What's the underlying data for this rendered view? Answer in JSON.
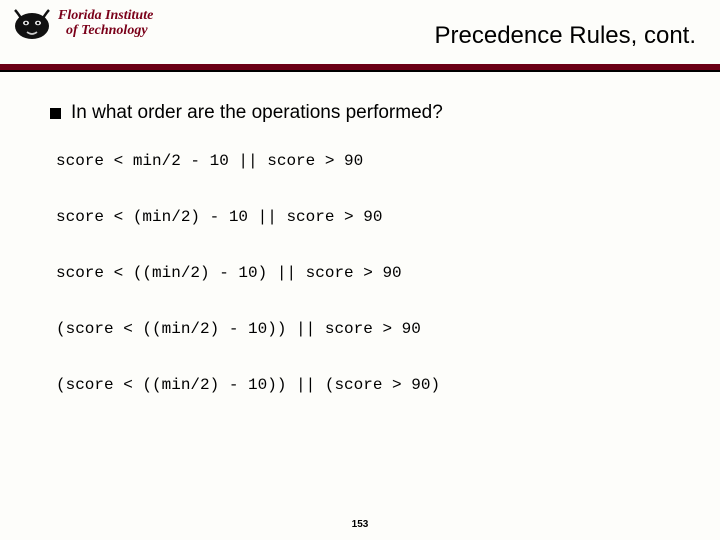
{
  "logo": {
    "line1": "Florida Institute",
    "line2": "of Technology"
  },
  "title": "Precedence Rules, cont.",
  "bullet_text": "In what order are the operations performed?",
  "code_lines": [
    "score < min/2 - 10 || score > 90",
    "score < (min/2) - 10 || score > 90",
    "score < ((min/2) - 10) || score > 90",
    "(score < ((min/2) - 10)) || score > 90",
    "(score < ((min/2) - 10)) || (score > 90)"
  ],
  "page_number": "153"
}
